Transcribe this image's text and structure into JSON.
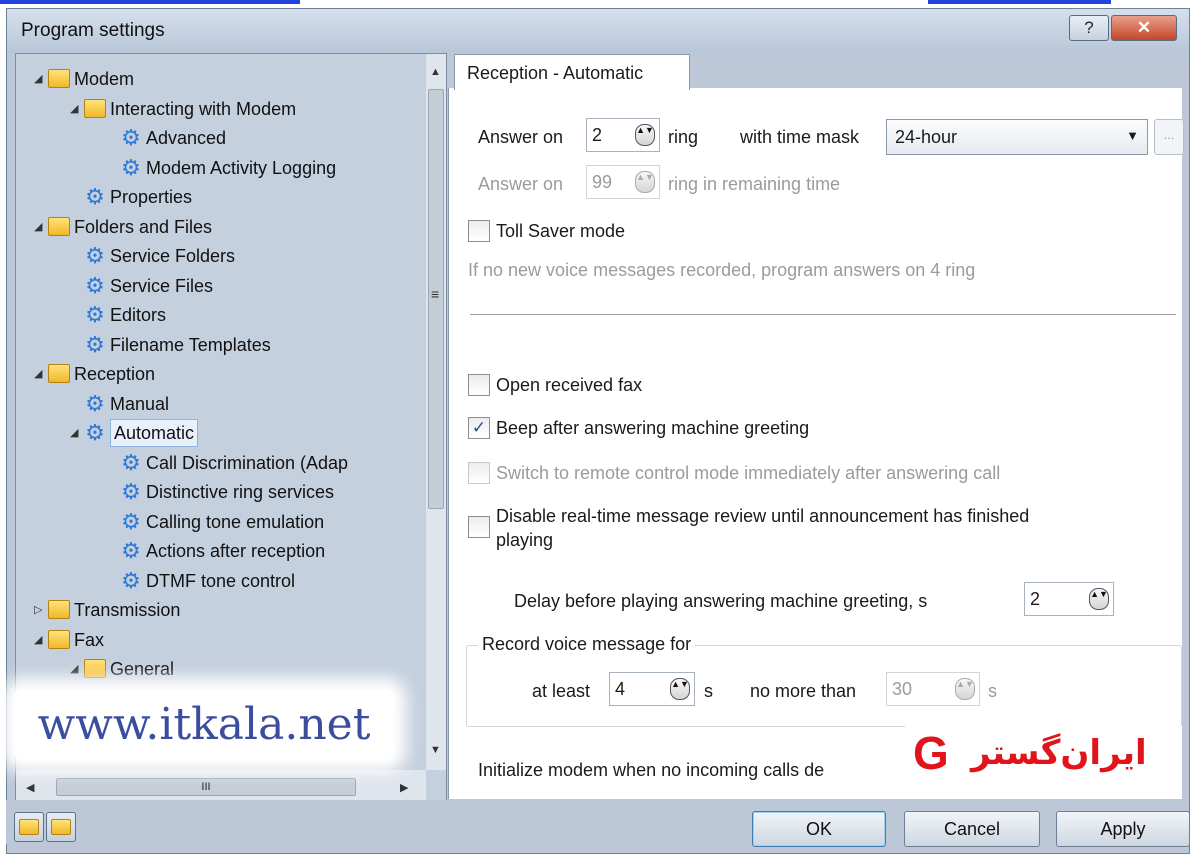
{
  "window": {
    "title": "Program settings",
    "help_label": "?",
    "close_label": "✕"
  },
  "tree": {
    "items": [
      {
        "label": "Modem",
        "icon": "folder-icon",
        "expander": "◢"
      },
      {
        "label": "Interacting with Modem",
        "icon": "folder-icon",
        "expander": "◢"
      },
      {
        "label": "Advanced",
        "icon": "gear-icon",
        "expander": ""
      },
      {
        "label": "Modem Activity Logging",
        "icon": "gear-icon",
        "expander": ""
      },
      {
        "label": "Properties",
        "icon": "gear-icon",
        "expander": ""
      },
      {
        "label": "Folders and Files",
        "icon": "folder-icon",
        "expander": "◢"
      },
      {
        "label": "Service Folders",
        "icon": "gear-icon",
        "expander": ""
      },
      {
        "label": "Service Files",
        "icon": "gear-icon",
        "expander": ""
      },
      {
        "label": "Editors",
        "icon": "gear-icon",
        "expander": ""
      },
      {
        "label": "Filename Templates",
        "icon": "gear-icon",
        "expander": ""
      },
      {
        "label": "Reception",
        "icon": "folder-icon",
        "expander": "◢"
      },
      {
        "label": "Manual",
        "icon": "gear-icon",
        "expander": ""
      },
      {
        "label": "Automatic",
        "icon": "gear-icon",
        "expander": "◢"
      },
      {
        "label": "Call Discrimination (Adap",
        "icon": "gear-icon",
        "expander": ""
      },
      {
        "label": "Distinctive ring services",
        "icon": "gear-icon",
        "expander": ""
      },
      {
        "label": "Calling tone emulation",
        "icon": "gear-icon",
        "expander": ""
      },
      {
        "label": "Actions after reception",
        "icon": "gear-icon",
        "expander": ""
      },
      {
        "label": "DTMF tone control",
        "icon": "gear-icon",
        "expander": ""
      },
      {
        "label": "Transmission",
        "icon": "folder-icon",
        "expander": "▷"
      },
      {
        "label": "Fax",
        "icon": "folder-icon",
        "expander": "◢"
      },
      {
        "label": "General",
        "icon": "folder-icon",
        "expander": "◢"
      }
    ],
    "selected": "Automatic",
    "scroll_up": "▲",
    "scroll_down": "▼",
    "scroll_grip": "≡",
    "scroll_left": "◀",
    "scroll_right": "▶",
    "hscroll_grip": "III"
  },
  "watermark": "www.itkala.net",
  "tab": {
    "label": "Reception - Automatic"
  },
  "form": {
    "answer_on_label": "Answer on",
    "answer_on_value": "2",
    "ring_label": "ring",
    "time_mask_label": "with time mask",
    "time_mask_value": "24-hour",
    "combo_arrow": "▼",
    "ellipsis": "...",
    "answer_on2_label": "Answer on",
    "answer_on2_value": "99",
    "ring_remaining_label": "ring in remaining time",
    "toll_saver_label": "Toll Saver mode",
    "toll_saver_hint": "If no new voice messages recorded, program answers on 4 ring",
    "open_fax_label": "Open received fax",
    "beep_label": "Beep after answering machine greeting",
    "beep_checked": "✓",
    "switch_remote_label": "Switch to remote control mode immediately after answering call",
    "disable_review_line1": "Disable real-time message review until announcement has finished",
    "disable_review_line2": "playing",
    "delay_label": "Delay before playing answering machine greeting, s",
    "delay_value": "2",
    "record_group_title": "Record voice message for",
    "at_least_label": "at least",
    "at_least_value": "4",
    "s_label": "s",
    "no_more_than_label": "no more than",
    "no_more_than_value": "30",
    "s2_label": "s",
    "init_modem_label": "Initialize modem when no incoming calls de",
    "spin_glyph": "▲▼"
  },
  "logo": {
    "g": "G",
    "text": "ایران‌گستر"
  },
  "buttons": {
    "ok": "OK",
    "cancel": "Cancel",
    "apply": "Apply"
  }
}
